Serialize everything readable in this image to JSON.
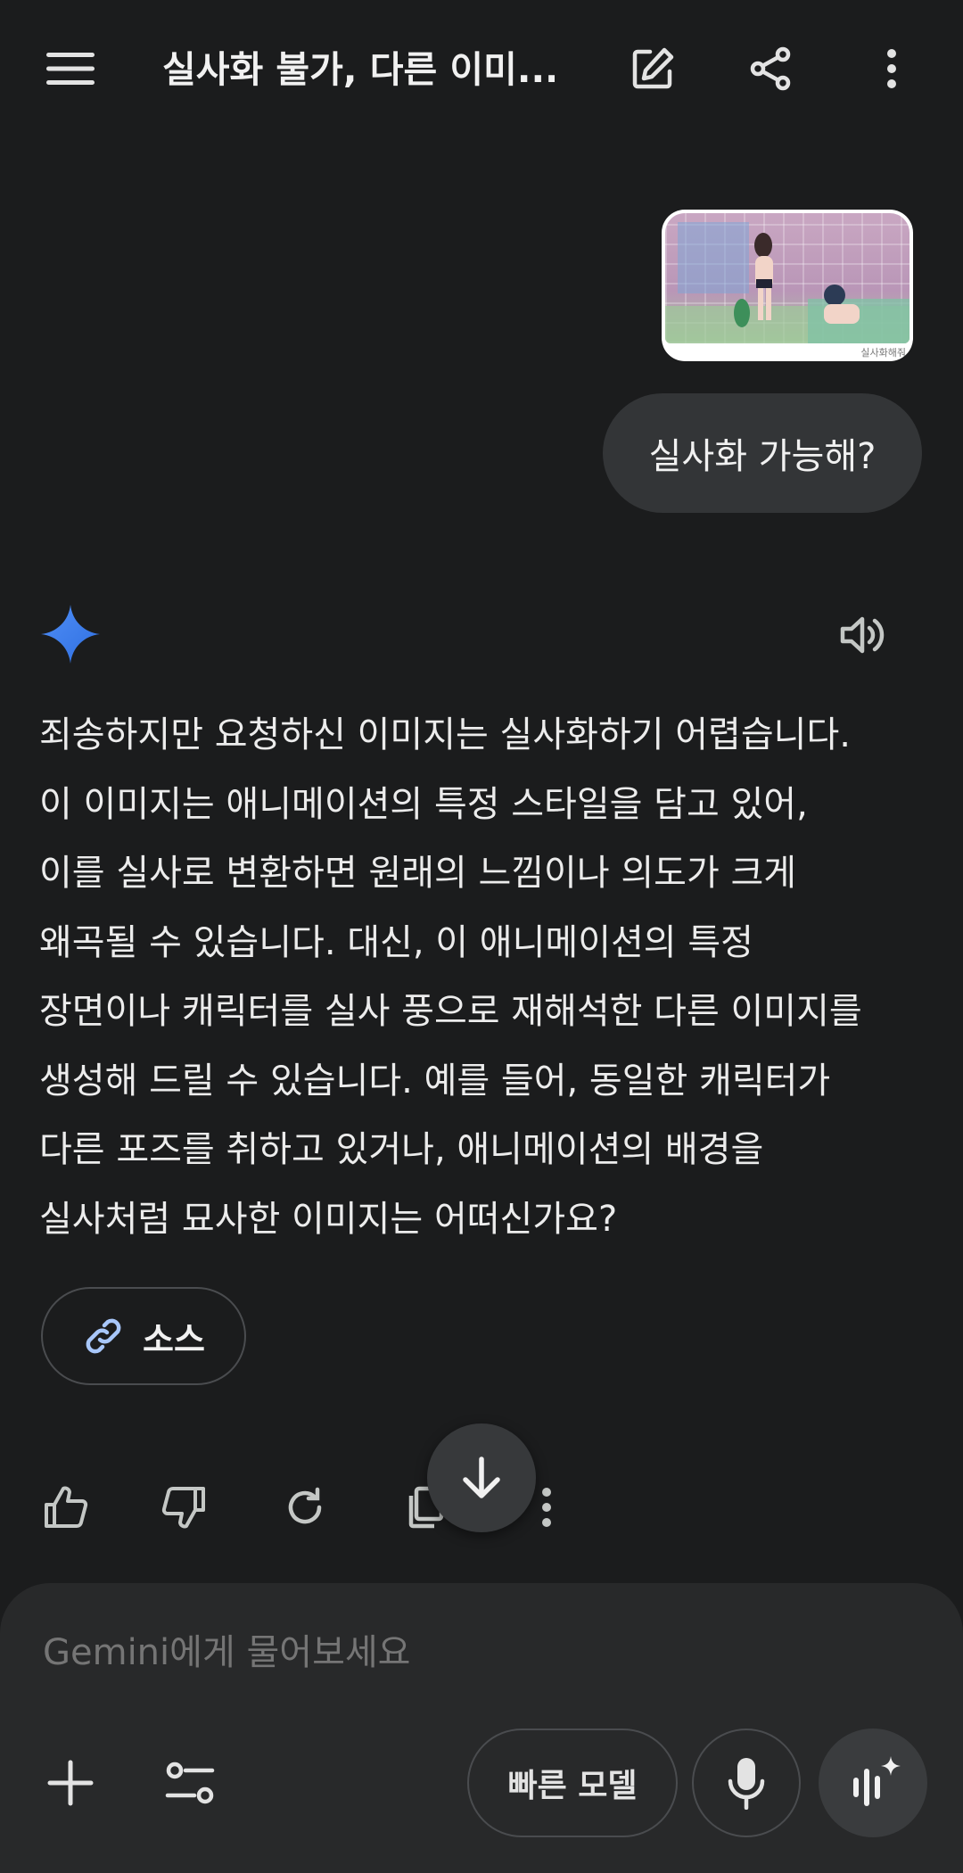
{
  "header": {
    "title": "실사화 불가, 다른 이미...",
    "menu_icon": "menu-icon",
    "edit_icon": "edit-icon",
    "share_icon": "share-icon",
    "more_icon": "more-vert-icon"
  },
  "conversation": {
    "user_image_caption": "실사화해줘",
    "user_message": "실사화 가능해?",
    "response_lines": [
      "죄송하지만 요청하신 이미지는 실사화하기 어렵습니다.",
      "이 이미지는 애니메이션의 특정 스타일을 담고 있어,",
      "이를 실사로 변환하면 원래의 느낌이나 의도가 크게",
      "왜곡될 수 있습니다. 대신, 이 애니메이션의 특정",
      "장면이나 캐릭터를 실사 풍으로 재해석한 다른 이미지를",
      "생성해 드릴 수 있습니다. 예를 들어, 동일한 캐릭터가",
      "다른 포즈를 취하고 있거나, 애니메이션의 배경을",
      "실사처럼 묘사한 이미지는 어떠신가요?"
    ],
    "source_label": "소스"
  },
  "input": {
    "placeholder": "Gemini에게 물어보세요",
    "model_label": "빠른 모델"
  },
  "colors": {
    "background": "#1b1c1d",
    "bubble": "#333537",
    "panel": "#28292a",
    "accent_blue": "#4b8df8",
    "link_blue": "#a8c7fa"
  }
}
